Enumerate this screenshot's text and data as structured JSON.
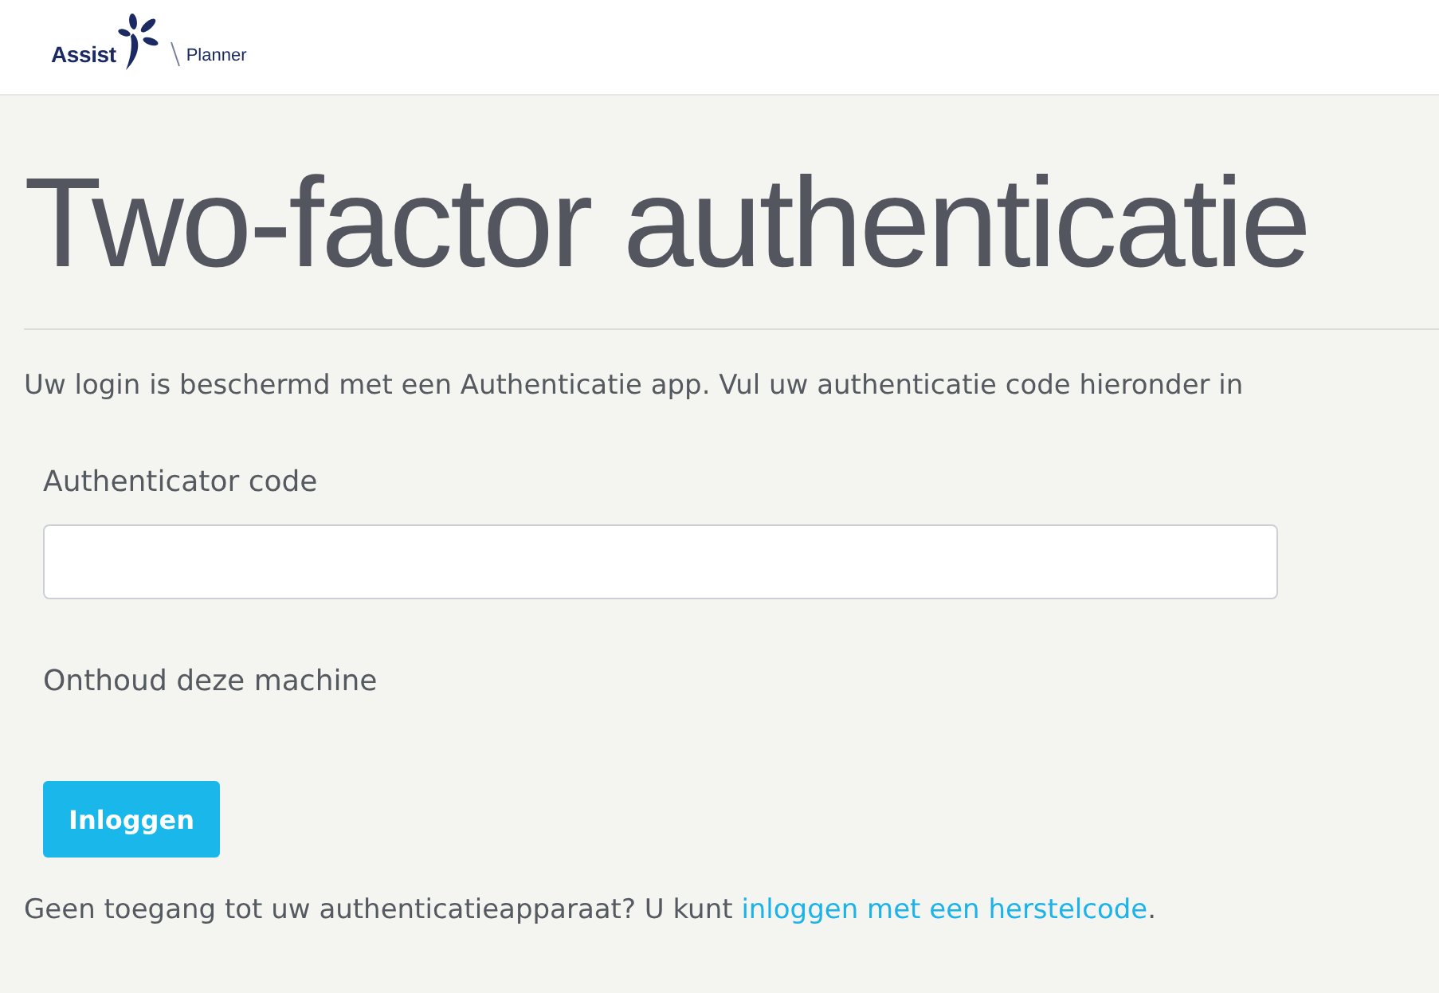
{
  "header": {
    "logo": {
      "brand": "Assist",
      "product": "Planner"
    }
  },
  "title": "Two-factor authenticatie",
  "intro": "Uw login is beschermd met een Authenticatie app. Vul uw authenticatie code hieronder in",
  "form": {
    "code_field": {
      "label": "Authenticator code"
    },
    "remember_label": "Onthoud deze machine",
    "submit": "Inloggen"
  },
  "footer": {
    "text": "Geen toegang tot uw authenticatieapparaat? U kunt ",
    "link": "inloggen met een herstelcode",
    "suffix": "."
  }
}
